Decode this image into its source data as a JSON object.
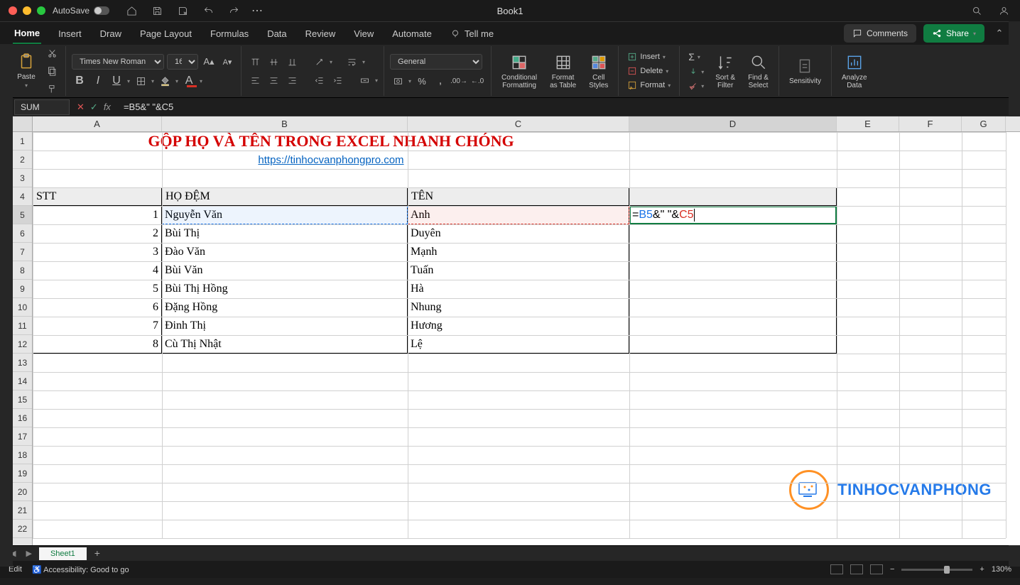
{
  "titlebar": {
    "autosave": "AutoSave",
    "doc": "Book1"
  },
  "tabs": {
    "items": [
      "Home",
      "Insert",
      "Draw",
      "Page Layout",
      "Formulas",
      "Data",
      "Review",
      "View",
      "Automate"
    ],
    "tellme": "Tell me",
    "comments": "Comments",
    "share": "Share"
  },
  "ribbon": {
    "paste": "Paste",
    "font": "Times New Roman",
    "size": "16",
    "numfmt": "General",
    "cond": "Conditional\nFormatting",
    "fmtTable": "Format\nas Table",
    "cellStyles": "Cell\nStyles",
    "insert": "Insert",
    "delete": "Delete",
    "format": "Format",
    "sortfilter": "Sort &\nFilter",
    "findselect": "Find &\nSelect",
    "sensitivity": "Sensitivity",
    "analyze": "Analyze\nData"
  },
  "fbar": {
    "name": "SUM",
    "formula": "=B5&\" \"&C5"
  },
  "cols": [
    "A",
    "B",
    "C",
    "D",
    "E",
    "F",
    "G"
  ],
  "sheet": {
    "title": "GỘP HỌ VÀ TÊN TRONG EXCEL NHANH CHÓNG",
    "link": "https://tinhocvanphongpro.com",
    "headers": {
      "stt": "STT",
      "hodem": "HỌ ĐỆM",
      "ten": "TÊN"
    },
    "rows": [
      {
        "n": "1",
        "b": "Nguyễn Văn",
        "c": "Anh"
      },
      {
        "n": "2",
        "b": "Bùi Thị",
        "c": "Duyên"
      },
      {
        "n": "3",
        "b": "Đào Văn",
        "c": "Mạnh"
      },
      {
        "n": "4",
        "b": "Bùi Văn",
        "c": "Tuấn"
      },
      {
        "n": "5",
        "b": "Bùi Thị Hồng",
        "c": "Hà"
      },
      {
        "n": "6",
        "b": "Đặng Hồng",
        "c": "Nhung"
      },
      {
        "n": "7",
        "b": "Đinh Thị",
        "c": "Hương"
      },
      {
        "n": "8",
        "b": "Cù Thị Nhật",
        "c": "Lệ"
      }
    ],
    "editing": {
      "b5": "B5",
      "c5": "C5"
    }
  },
  "sheettab": "Sheet1",
  "status": {
    "mode": "Edit",
    "acc": "Accessibility: Good to go",
    "zoom": "130%"
  },
  "watermark": "TINHOCVANPHONG"
}
